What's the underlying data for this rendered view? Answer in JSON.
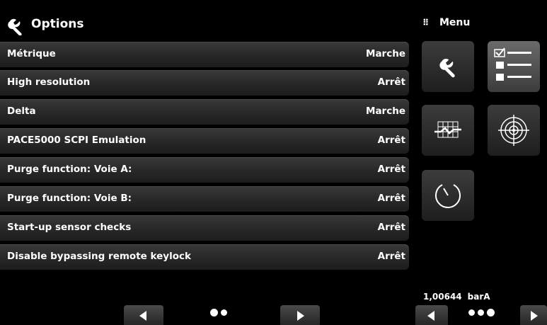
{
  "header": {
    "title": "Options",
    "icon": "wrench-icon"
  },
  "menu": {
    "title": "Menu",
    "icon": "grip-icon"
  },
  "options": [
    {
      "label": "Métrique",
      "value": "Marche"
    },
    {
      "label": "High resolution",
      "value": "Arrêt"
    },
    {
      "label": "Delta",
      "value": "Marche"
    },
    {
      "label": "PACE5000 SCPI Emulation",
      "value": "Arrêt"
    },
    {
      "label": "Purge function: Voie A:",
      "value": "Arrêt"
    },
    {
      "label": "Purge function: Voie B:",
      "value": "Arrêt"
    },
    {
      "label": "Start-up sensor checks",
      "value": "Arrêt"
    },
    {
      "label": "Disable bypassing remote keylock",
      "value": "Arrêt"
    }
  ],
  "menu_tiles": [
    {
      "name": "settings-tile",
      "icon": "wrench-icon",
      "active": false
    },
    {
      "name": "options-list-tile",
      "icon": "checklist-icon",
      "active": true
    },
    {
      "name": "chart-tile",
      "icon": "chart-icon",
      "active": false
    },
    {
      "name": "target-tile",
      "icon": "target-icon",
      "active": false
    },
    {
      "name": "gauge-tile",
      "icon": "gauge-icon",
      "active": false
    }
  ],
  "reading": {
    "value": "1,00644",
    "unit": "barA"
  },
  "pager_left": {
    "pages": 2,
    "current": 1
  },
  "pager_right": {
    "pages": 3,
    "current": 3
  }
}
